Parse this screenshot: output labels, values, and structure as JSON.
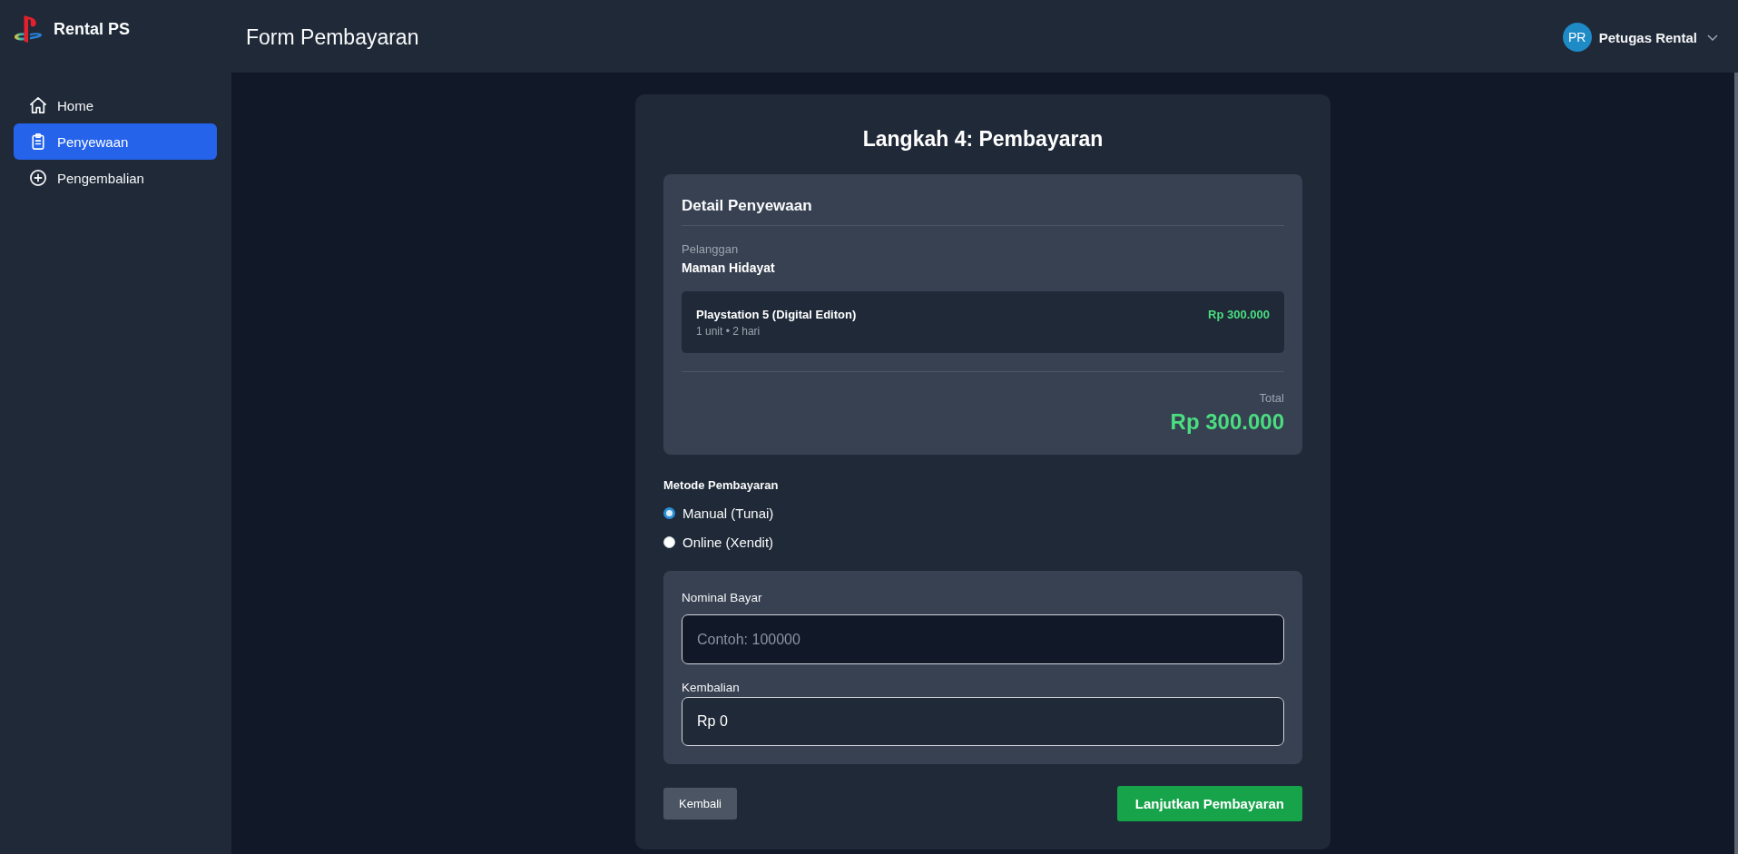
{
  "sidebar": {
    "brand": "Rental PS",
    "items": [
      {
        "label": "Home",
        "selected": false
      },
      {
        "label": "Penyewaan",
        "selected": true
      },
      {
        "label": "Pengembalian",
        "selected": false
      }
    ]
  },
  "header": {
    "title": "Form Pembayaran",
    "user": {
      "initials": "PR",
      "name": "Petugas Rental"
    }
  },
  "form": {
    "title": "Langkah 4: Pembayaran",
    "detail": {
      "heading": "Detail Penyewaan",
      "customer_label": "Pelanggan",
      "customer_name": "Maman Hidayat",
      "items": [
        {
          "name": "Playstation 5 (Digital Editon)",
          "meta": "1 unit • 2 hari",
          "price": "Rp 300.000"
        }
      ],
      "total_label": "Total",
      "total": "Rp 300.000"
    },
    "payment_method": {
      "label": "Metode Pembayaran",
      "options": [
        {
          "label": "Manual (Tunai)",
          "selected": true
        },
        {
          "label": "Online (Xendit)",
          "selected": false
        }
      ]
    },
    "cash": {
      "fields": [
        {
          "kind": "input",
          "label": "Nominal Bayar",
          "placeholder": "Contoh: 100000"
        },
        {
          "kind": "readonly",
          "label": "Kembalian",
          "value": "Rp 0"
        }
      ]
    },
    "buttons": [
      {
        "kind": "secondary",
        "label": "Kembali"
      },
      {
        "kind": "primary",
        "label": "Lanjutkan Pembayaran"
      }
    ]
  }
}
